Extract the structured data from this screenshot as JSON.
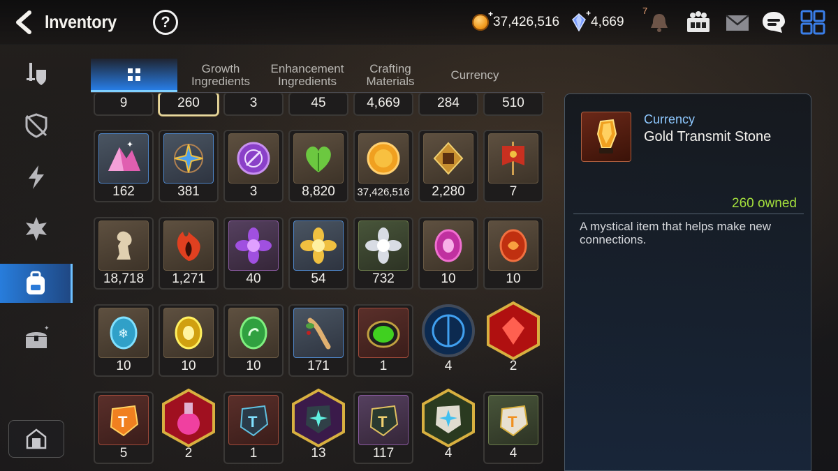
{
  "header": {
    "title": "Inventory",
    "help_label": "?",
    "gold_amount": "37,426,516",
    "crystal_amount": "4,669",
    "notification_count": "7"
  },
  "sidebar": {
    "items": [
      {
        "icon": "gear-equipment-icon"
      },
      {
        "icon": "artifact-shield-icon"
      },
      {
        "icon": "lightning-icon"
      },
      {
        "icon": "catalyst-icon"
      },
      {
        "icon": "backpack-icon",
        "active": true
      },
      {
        "icon": "treasure-chest-icon"
      }
    ],
    "bottom_icon": "storage-icon"
  },
  "tabs": [
    {
      "label": "",
      "icon": "grid-icon",
      "active": true
    },
    {
      "label": "Growth\nIngredients"
    },
    {
      "label": "Enhancement\nIngredients"
    },
    {
      "label": "Crafting\nMaterials"
    },
    {
      "label": "Currency"
    }
  ],
  "grid": {
    "partial_row": [
      "9",
      "260",
      "3",
      "45",
      "4,669",
      "284",
      "510"
    ],
    "rows": [
      [
        {
          "qty": "162",
          "icon": "pink-crystal-icon",
          "tone": "blue"
        },
        {
          "qty": "381",
          "icon": "star-compass-icon",
          "tone": "blue"
        },
        {
          "qty": "3",
          "icon": "purple-seal-icon",
          "tone": "brown"
        },
        {
          "qty": "8,820",
          "icon": "leaf-icon",
          "tone": "brown"
        },
        {
          "qty": "37,426,516",
          "icon": "gold-coin-icon",
          "tone": "brown"
        },
        {
          "qty": "2,280",
          "icon": "guild-emblem-icon",
          "tone": "brown"
        },
        {
          "qty": "7",
          "icon": "banner-icon",
          "tone": "brown"
        }
      ],
      [
        {
          "qty": "18,718",
          "icon": "knight-piece-icon",
          "tone": "brown"
        },
        {
          "qty": "1,271",
          "icon": "flame-leaf-icon",
          "tone": "brown"
        },
        {
          "qty": "40",
          "icon": "purple-flower-icon",
          "tone": "purple"
        },
        {
          "qty": "54",
          "icon": "gold-flower-icon",
          "tone": "blue"
        },
        {
          "qty": "732",
          "icon": "silver-flower-icon",
          "tone": "green"
        },
        {
          "qty": "10",
          "icon": "pink-rune-icon",
          "tone": "brown"
        },
        {
          "qty": "10",
          "icon": "red-rune-icon",
          "tone": "brown"
        }
      ],
      [
        {
          "qty": "10",
          "icon": "ice-rune-icon",
          "tone": "brown"
        },
        {
          "qty": "10",
          "icon": "yellow-rune-icon",
          "tone": "brown"
        },
        {
          "qty": "10",
          "icon": "green-rune-icon",
          "tone": "brown"
        },
        {
          "qty": "171",
          "icon": "root-herb-icon",
          "tone": "blue"
        },
        {
          "qty": "1",
          "icon": "green-orb-icon",
          "tone": "red"
        },
        {
          "qty": "4",
          "icon": "blue-sigil-icon",
          "tone": "hex-blue"
        },
        {
          "qty": "2",
          "icon": "red-gem-icon",
          "tone": "hex-red"
        }
      ],
      [
        {
          "qty": "5",
          "icon": "red-hammer-stone-icon",
          "tone": "red"
        },
        {
          "qty": "2",
          "icon": "pink-potion-icon",
          "tone": "hex-red"
        },
        {
          "qty": "1",
          "icon": "blue-hammer-stone-icon",
          "tone": "red"
        },
        {
          "qty": "13",
          "icon": "teal-star-stone-icon",
          "tone": "hex-purple"
        },
        {
          "qty": "117",
          "icon": "green-hammer-stone-icon",
          "tone": "purple"
        },
        {
          "qty": "4",
          "icon": "white-star-stone-icon",
          "tone": "hex-gold"
        },
        {
          "qty": "4",
          "icon": "gold-hammer-stone-icon",
          "tone": "green"
        }
      ]
    ],
    "selected_qty": "260"
  },
  "detail": {
    "category": "Currency",
    "name": "Gold Transmit Stone",
    "owned": "260 owned",
    "description": "A mystical item that helps make new connections.",
    "icon": "gold-transmit-stone-icon"
  },
  "colors": {
    "accent_blue": "#2a86e6",
    "owned_green": "#a4e03c",
    "category_blue": "#8ec8ff"
  }
}
